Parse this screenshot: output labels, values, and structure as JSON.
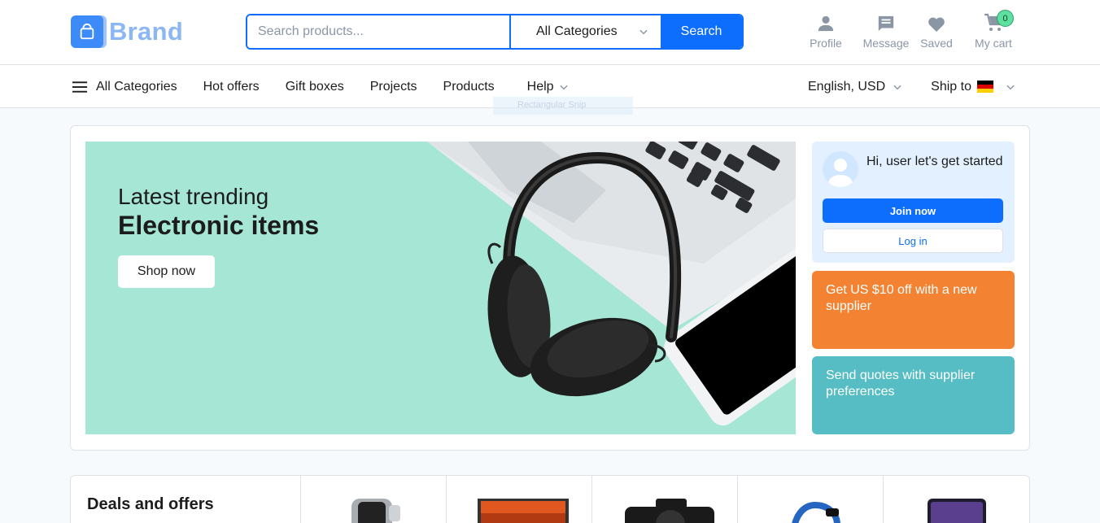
{
  "brand": {
    "name": "Brand"
  },
  "search": {
    "placeholder": "Search products...",
    "category": "All Categories",
    "button_label": "Search"
  },
  "header_actions": {
    "profile": "Profile",
    "message": "Message",
    "saved": "Saved",
    "cart": "My cart",
    "cart_count": "0"
  },
  "nav": {
    "all_categories": "All Categories",
    "items": [
      "Hot offers",
      "Gift boxes",
      "Projects",
      "Products"
    ],
    "help": "Help",
    "language": "English, USD",
    "ship_to": "Ship to"
  },
  "overlay": {
    "snip_label": "Rectangular Snip"
  },
  "banner": {
    "line1": "Latest trending",
    "line2": "Electronic items",
    "button": "Shop now"
  },
  "user_card": {
    "greeting": "Hi, user let's get started",
    "join": "Join now",
    "login": "Log in"
  },
  "promos": {
    "orange": "Get US $10 off with a new supplier",
    "teal": "Send quotes with supplier preferences"
  },
  "deals": {
    "title": "Deals and offers"
  },
  "colors": {
    "primary": "#0d6efd",
    "orange": "#f38332",
    "teal": "#55bdc3",
    "banner_bg": "#a6e6d5"
  }
}
